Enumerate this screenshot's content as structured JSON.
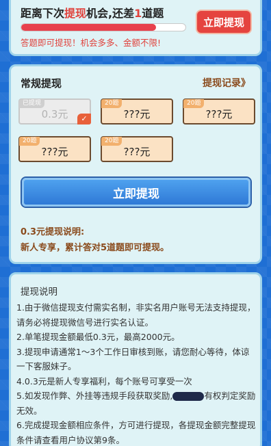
{
  "top": {
    "title_prefix": "距离下次",
    "title_highlight": "提现",
    "title_middle": "机会,还差",
    "title_count": "1",
    "title_suffix": "道题",
    "progress": 0.82,
    "subtitle": "答题即可提现！机会多多、金额不限!",
    "button_label": "立即提现"
  },
  "main": {
    "title": "常规提现",
    "records_link": "提现记录》",
    "options": [
      {
        "tag": "已提现",
        "amount": "0.3元",
        "state": "withdrawn",
        "selected": true
      },
      {
        "tag": "20题",
        "amount": "???元",
        "state": "locked"
      },
      {
        "tag": "20题",
        "amount": "???元",
        "state": "locked"
      },
      {
        "tag": "20题",
        "amount": "???元",
        "state": "locked"
      },
      {
        "tag": "20题",
        "amount": "???元",
        "state": "locked"
      }
    ],
    "button_label": "立即提现",
    "note_title": "0.3元提现说明:",
    "note_text": "新人专享，累计答对5道题即可提现。"
  },
  "rules": {
    "title": "提现说明",
    "items": [
      "1.由于微信提现支付需实名制，非实名用户账号无法支持提现，请务必将提现微信号进行实名认证。",
      "2.单笔提现金额最低0.3元，最高2000元。",
      "3.提现申请通常1～3个工作日审核到账，请您耐心等待，体谅一下客服妹子。",
      "4.0.3元是新人专享福利，每个账号可享受一次",
      "6.完成提现金额相应条件，方可进行提现，各提现金额完整提现条件请查看用户协议第9条。"
    ],
    "item5_before": "5.如发现作弊、外挂等违规手段获取奖励,",
    "item5_after": "有权判定奖励无效。"
  },
  "colors": {
    "accent_red": "#e5443f",
    "accent_blue": "#2f79d6",
    "brown_text": "#8a4a1c",
    "page_bg": "#1f6fd4"
  }
}
